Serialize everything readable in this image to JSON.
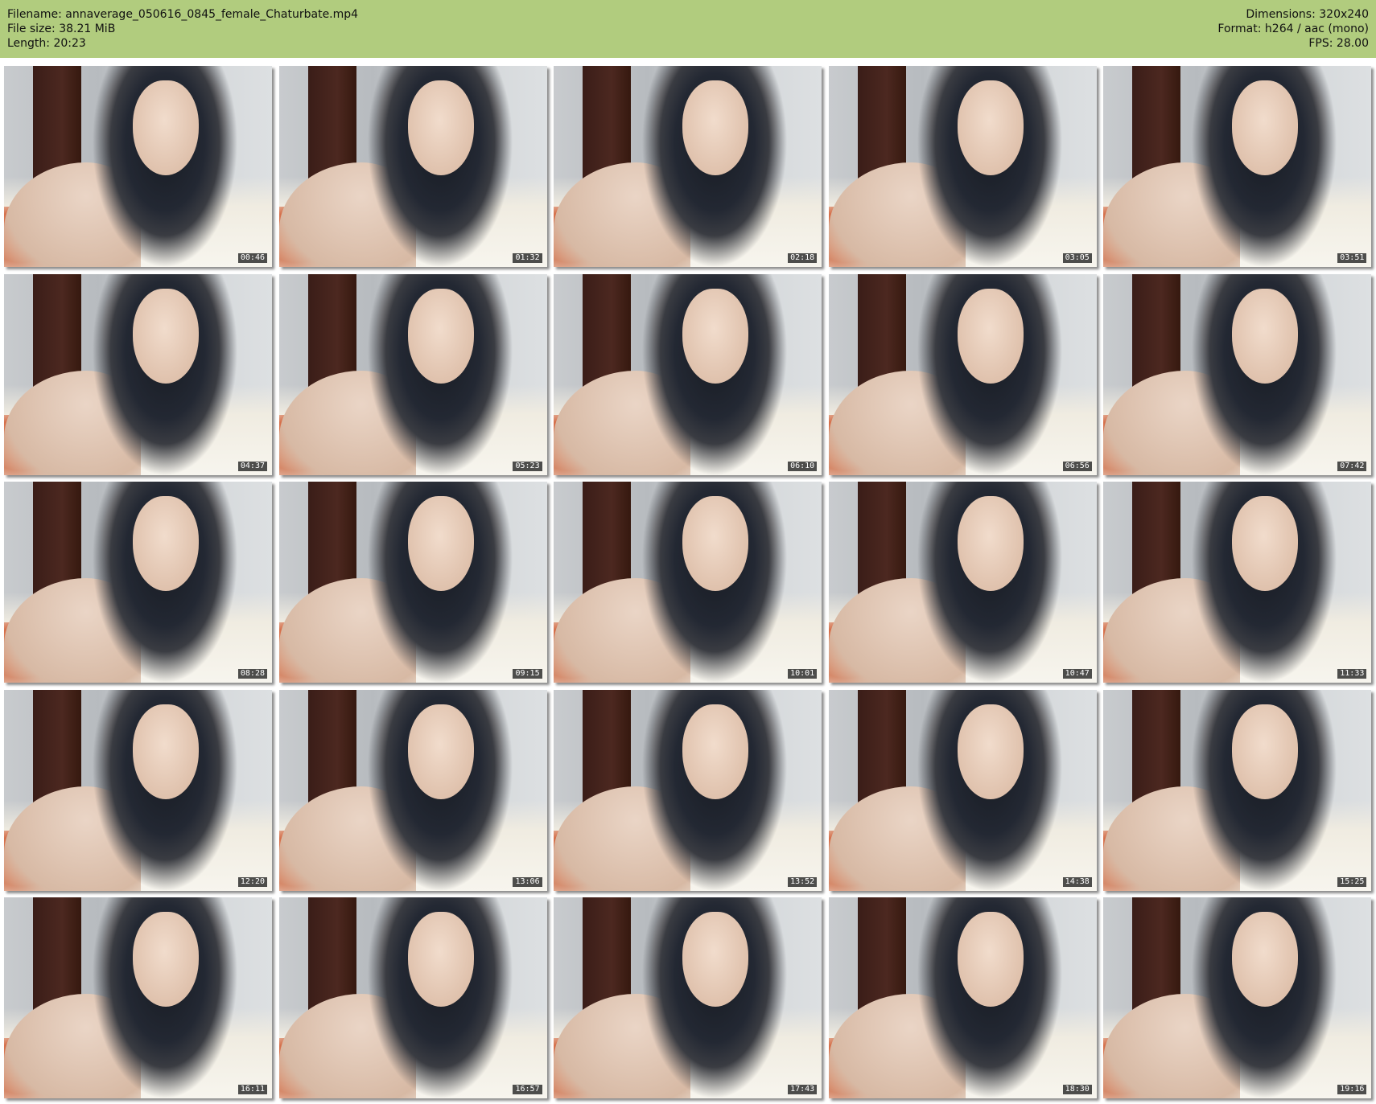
{
  "header": {
    "filename": "Filename: annaverage_050616_0845_female_Chaturbate.mp4",
    "filesize": "File size: 38.21 MiB",
    "length": "Length: 20:23",
    "dimensions": "Dimensions: 320x240",
    "format": "Format: h264 / aac (mono)",
    "fps": "FPS: 28.00"
  },
  "colors": {
    "header_bg": "#b1cc7e",
    "page_bg": "#ffffff"
  },
  "thumbnails": [
    {
      "time": "00:46",
      "wm": ""
    },
    {
      "time": "01:32",
      "wm": ""
    },
    {
      "time": "02:18",
      "wm": ""
    },
    {
      "time": "03:05",
      "wm": ""
    },
    {
      "time": "03:51",
      "wm": ""
    },
    {
      "time": "04:37",
      "wm": ""
    },
    {
      "time": "05:23",
      "wm": ""
    },
    {
      "time": "06:10",
      "wm": ""
    },
    {
      "time": "06:56",
      "wm": ""
    },
    {
      "time": "07:42",
      "wm": ""
    },
    {
      "time": "08:28",
      "wm": ""
    },
    {
      "time": "09:15",
      "wm": ""
    },
    {
      "time": "10:01",
      "wm": ""
    },
    {
      "time": "10:47",
      "wm": ""
    },
    {
      "time": "11:33",
      "wm": ""
    },
    {
      "time": "12:20",
      "wm": ""
    },
    {
      "time": "13:06",
      "wm": ""
    },
    {
      "time": "13:52",
      "wm": ""
    },
    {
      "time": "14:38",
      "wm": ""
    },
    {
      "time": "15:25",
      "wm": ""
    },
    {
      "time": "16:11",
      "wm": ""
    },
    {
      "time": "16:57",
      "wm": ""
    },
    {
      "time": "17:43",
      "wm": ""
    },
    {
      "time": "18:30",
      "wm": ""
    },
    {
      "time": "19:16",
      "wm": ""
    }
  ]
}
